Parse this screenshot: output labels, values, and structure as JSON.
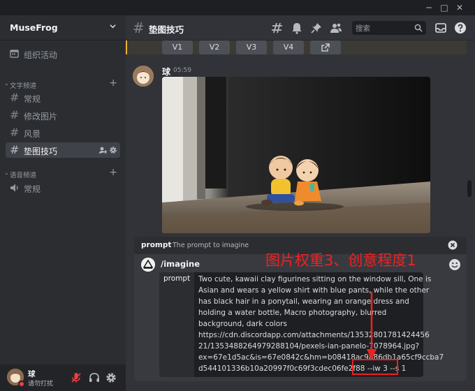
{
  "window": {
    "minimize_glyph": "─",
    "maximize_glyph": "□",
    "close_glyph": "✕"
  },
  "server": {
    "name": "MuseFrog"
  },
  "sidebar": {
    "events_label": "组织活动",
    "text_category": "文字频道",
    "text_channels": [
      {
        "label": "常规"
      },
      {
        "label": "修改图片"
      },
      {
        "label": "风景"
      },
      {
        "label": "垫图技巧",
        "active": true
      }
    ],
    "voice_category": "语音频道",
    "voice_channels": [
      {
        "label": "常规"
      }
    ]
  },
  "user": {
    "name": "球",
    "status": "请勿打扰"
  },
  "channel": {
    "title": "垫图技巧",
    "search_placeholder": "搜索"
  },
  "variation_buttons": [
    "V1",
    "V2",
    "V3",
    "V4"
  ],
  "message": {
    "author": "球",
    "time": "05:59"
  },
  "command_popup": {
    "name": "prompt",
    "description": "The prompt to imagine"
  },
  "composer": {
    "command": "/imagine",
    "option_label": "prompt",
    "prompt_lines": [
      "Two cute, kawaii clay figurines sitting on the window sill, One is",
      "Asian and wears a yellow shirt with blue pants, while the other",
      "has black hair in a ponytail, wearing an orange dress and",
      "holding a water bottle, Macro photography, blurred",
      "background, dark colors",
      "https://cdn.discordapp.com/attachments/13532801781424456",
      "21/1353488264979288104/pexels-ian-panelo-7078964.jpg?",
      "ex=67e1d5ac&is=67e0842c&hm=b08418ac9886db1a65cf9ccba7",
      "d544101336b10a20997f0c69f3cdec06fe2f88"
    ],
    "prompt_params": "--iw 3 --s 1"
  },
  "annotation": {
    "text": "图片权重3、创意程度1",
    "color": "#ee2222"
  },
  "colors": {
    "background": "#313338",
    "sidebar": "#2b2d31",
    "accent_bar": "#f0b232",
    "annotation": "#ee2222",
    "dnd_status": "#f23f43"
  }
}
